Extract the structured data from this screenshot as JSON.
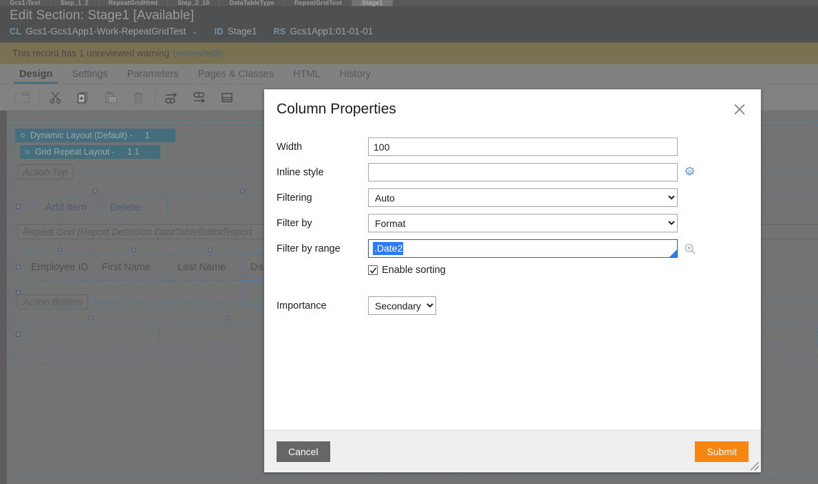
{
  "browser_tabs": [
    {
      "label": "Gcs1-Test",
      "active": false
    },
    {
      "label": "Step_1_2",
      "active": false
    },
    {
      "label": "RepeatGridHtml",
      "active": false
    },
    {
      "label": "Step_2_10",
      "active": false
    },
    {
      "label": "DataTableType",
      "active": false
    },
    {
      "label": "RepeatGridTest",
      "active": false
    },
    {
      "label": "Stage1",
      "active": true
    }
  ],
  "header": {
    "title": "Edit Section: Stage1 [Available]",
    "class_key": "CL",
    "class_value": "Gcs1-Gcs1App1-Work-RepeatGridTest",
    "id_key": "ID",
    "id_value": "Stage1",
    "rs_key": "RS",
    "rs_value": "Gcs1App1:01-01-01",
    "caret": "⌄"
  },
  "warning": {
    "text": "This record has 1 unreviewed warning",
    "link": "(review/edit)"
  },
  "tabs": [
    {
      "label": "Design",
      "selected": true
    },
    {
      "label": "Settings",
      "selected": false
    },
    {
      "label": "Parameters",
      "selected": false
    },
    {
      "label": "Pages & Classes",
      "selected": false
    },
    {
      "label": "HTML",
      "selected": false
    },
    {
      "label": "History",
      "selected": false
    }
  ],
  "toolbar": {
    "icons": [
      "select-region-icon",
      "cut-icon",
      "copy-icon",
      "paste-icon",
      "delete-icon",
      "indent-icon",
      "outdent-icon",
      "layout-icon"
    ]
  },
  "canvas": {
    "layer1_label": "Dynamic Layout (Default) -",
    "layer1_num": "1",
    "layer2_label": "Grid Repeat Layout -",
    "layer2_num": "1.1",
    "action_top": "Action Top",
    "add_item": "Add Item",
    "delete": "Delete",
    "add_item_icon": "plus-circle-icon",
    "delete_icon": "x-circle-icon",
    "repeat_grid_label": "Repeat Grid [Report Definition DataTableEditorReport",
    "columns": [
      "Employee ID",
      "First Name",
      "Last Name",
      "Da"
    ],
    "action_bottom": "Action Bottom"
  },
  "modal": {
    "title": "Column Properties",
    "close_icon": "close-icon",
    "fields": {
      "width_label": "Width",
      "width_value": "100",
      "inline_style_label": "Inline style",
      "inline_style_value": "",
      "inline_style_gear_icon": "gear-icon",
      "filtering_label": "Filtering",
      "filtering_value": "Auto",
      "filtering_options": [
        "Auto"
      ],
      "filter_by_label": "Filter by",
      "filter_by_value": "Format",
      "filter_by_options": [
        "Format"
      ],
      "filter_by_range_label": "Filter by range",
      "filter_by_range_value": ".Date2",
      "filter_by_range_search_icon": "search-zoom-icon",
      "enable_sorting_label": "Enable sorting",
      "enable_sorting_checked": true,
      "importance_label": "Importance",
      "importance_value": "Secondary",
      "importance_options": [
        "Secondary"
      ]
    },
    "footer": {
      "cancel_label": "Cancel",
      "submit_label": "Submit",
      "cancel_color": "#666666",
      "submit_color": "#f6860f"
    },
    "resize_handle_icon": "resize-grip-icon"
  }
}
